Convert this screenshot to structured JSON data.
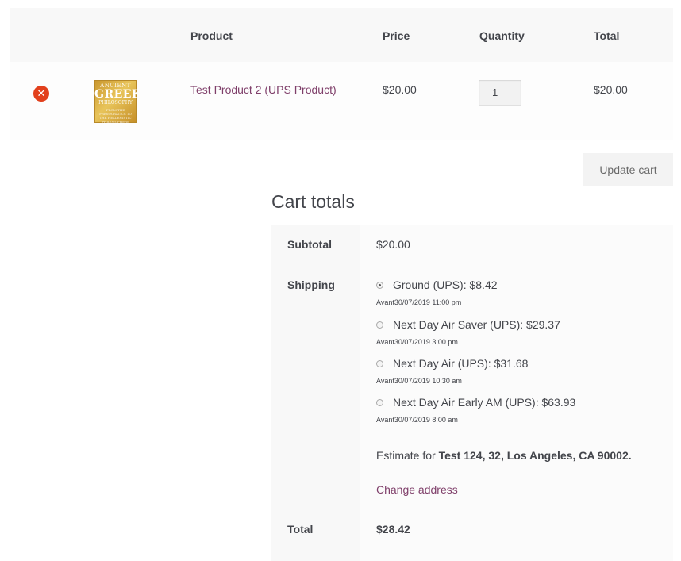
{
  "cart": {
    "headers": {
      "product": "Product",
      "price": "Price",
      "quantity": "Quantity",
      "total": "Total"
    },
    "items": [
      {
        "remove_icon": "close-circle-icon",
        "thumbnail": {
          "line1": "ANCIENT",
          "line2": "GREEK",
          "line3": "PHILOSOPHY",
          "line4": "FROM THE PRESOCRATICS TO THE HELLENISTIC PHILOSOPHERS"
        },
        "name": "Test Product 2 (UPS Product)",
        "price": "$20.00",
        "quantity": "1",
        "total": "$20.00"
      }
    ],
    "update_label": "Update cart"
  },
  "totals": {
    "title": "Cart totals",
    "subtotal_label": "Subtotal",
    "subtotal_value": "$20.00",
    "shipping_label": "Shipping",
    "shipping_options": [
      {
        "label": "Ground (UPS): $8.42",
        "date": "Avant30/07/2019 11:00 pm",
        "selected": true
      },
      {
        "label": "Next Day Air Saver (UPS): $29.37",
        "date": "Avant30/07/2019 3:00 pm",
        "selected": false
      },
      {
        "label": "Next Day Air (UPS): $31.68",
        "date": "Avant30/07/2019 10:30 am",
        "selected": false
      },
      {
        "label": "Next Day Air Early AM (UPS): $63.93",
        "date": "Avant30/07/2019 8:00 am",
        "selected": false
      }
    ],
    "estimate_prefix": "Estimate for ",
    "estimate_address": "Test 124, 32, Los Angeles, CA 90002.",
    "change_address_label": "Change address",
    "total_label": "Total",
    "total_value": "$28.42"
  },
  "colors": {
    "link": "#7f3f6a",
    "remove": "#e2401c",
    "text": "#43454b"
  }
}
